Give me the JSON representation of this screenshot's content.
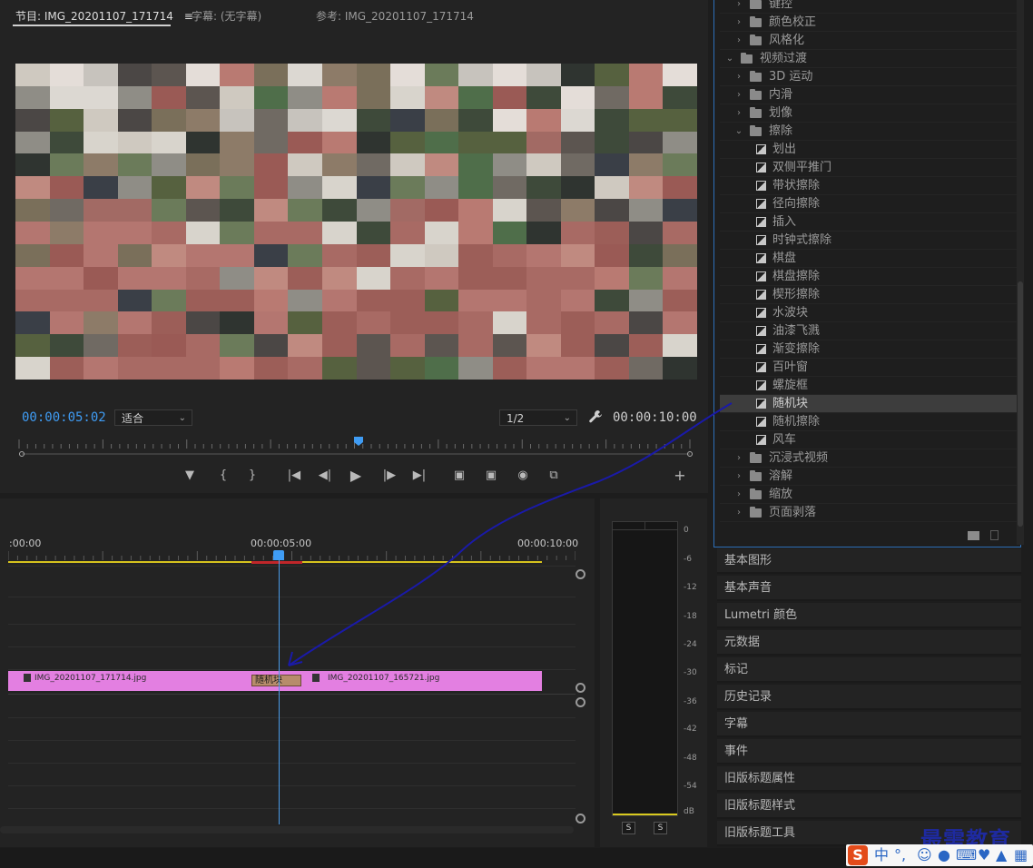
{
  "monitor": {
    "tabs": [
      {
        "label": "节目: IMG_20201107_171714",
        "menu_icon": "≡"
      },
      {
        "label": "字幕: (无字幕)"
      },
      {
        "label": "参考: IMG_20201107_171714"
      }
    ],
    "current_time": "00:00:05:02",
    "duration": "00:00:10:00",
    "fit_select": "适合",
    "resolution_select": "1/2",
    "playhead_fraction": 0.5
  },
  "effects_panel": {
    "items": [
      {
        "label": "键控",
        "type": "folder",
        "expanded": false,
        "level": 1
      },
      {
        "label": "颜色校正",
        "type": "folder",
        "expanded": false,
        "level": 1
      },
      {
        "label": "风格化",
        "type": "folder",
        "expanded": false,
        "level": 1
      },
      {
        "label": "视频过渡",
        "type": "folder",
        "expanded": true,
        "level": 0
      },
      {
        "label": "3D 运动",
        "type": "folder",
        "expanded": false,
        "level": 1
      },
      {
        "label": "内滑",
        "type": "folder",
        "expanded": false,
        "level": 1
      },
      {
        "label": "划像",
        "type": "folder",
        "expanded": false,
        "level": 1
      },
      {
        "label": "擦除",
        "type": "folder",
        "expanded": true,
        "level": 1
      },
      {
        "label": "划出",
        "type": "effect",
        "level": 2
      },
      {
        "label": "双侧平推门",
        "type": "effect",
        "level": 2
      },
      {
        "label": "带状擦除",
        "type": "effect",
        "level": 2
      },
      {
        "label": "径向擦除",
        "type": "effect",
        "level": 2
      },
      {
        "label": "插入",
        "type": "effect",
        "level": 2
      },
      {
        "label": "时钟式擦除",
        "type": "effect",
        "level": 2
      },
      {
        "label": "棋盘",
        "type": "effect",
        "level": 2
      },
      {
        "label": "棋盘擦除",
        "type": "effect",
        "level": 2
      },
      {
        "label": "楔形擦除",
        "type": "effect",
        "level": 2
      },
      {
        "label": "水波块",
        "type": "effect",
        "level": 2
      },
      {
        "label": "油漆飞溅",
        "type": "effect",
        "level": 2
      },
      {
        "label": "渐变擦除",
        "type": "effect",
        "level": 2
      },
      {
        "label": "百叶窗",
        "type": "effect",
        "level": 2
      },
      {
        "label": "螺旋框",
        "type": "effect",
        "level": 2
      },
      {
        "label": "随机块",
        "type": "effect",
        "level": 2,
        "selected": true
      },
      {
        "label": "随机擦除",
        "type": "effect",
        "level": 2
      },
      {
        "label": "风车",
        "type": "effect",
        "level": 2
      },
      {
        "label": "沉浸式视频",
        "type": "folder",
        "expanded": false,
        "level": 1
      },
      {
        "label": "溶解",
        "type": "folder",
        "expanded": false,
        "level": 1
      },
      {
        "label": "缩放",
        "type": "folder",
        "expanded": false,
        "level": 1
      },
      {
        "label": "页面剥落",
        "type": "folder",
        "expanded": false,
        "level": 1
      }
    ]
  },
  "panels": [
    "基本图形",
    "基本声音",
    "Lumetri 颜色",
    "元数据",
    "标记",
    "历史记录",
    "字幕",
    "事件",
    "旧版标题属性",
    "旧版标题样式",
    "旧版标题工具"
  ],
  "timeline": {
    "ruler": [
      ":00:00",
      "00:00:05:00",
      "00:00:10:00"
    ],
    "clip_a": "IMG_20201107_171714.jpg",
    "clip_b": "IMG_20201107_165721.jpg",
    "transition": "随机块"
  },
  "audio_meter": {
    "scale": [
      "0",
      "-6",
      "-12",
      "-18",
      "-24",
      "-30",
      "-36",
      "-42",
      "-48",
      "-54",
      "dB"
    ],
    "solo_left": "S",
    "solo_right": "S"
  },
  "watermark": "最需教育",
  "ime": {
    "mode": "中",
    "punct": "°,"
  },
  "colors": {
    "accent_blue": "#3f9cf4",
    "clip_pink": "#e37fe1",
    "transition_tan": "#b78c6b",
    "annotation": "#1a1aa8",
    "work_area": "#d5c21e"
  }
}
